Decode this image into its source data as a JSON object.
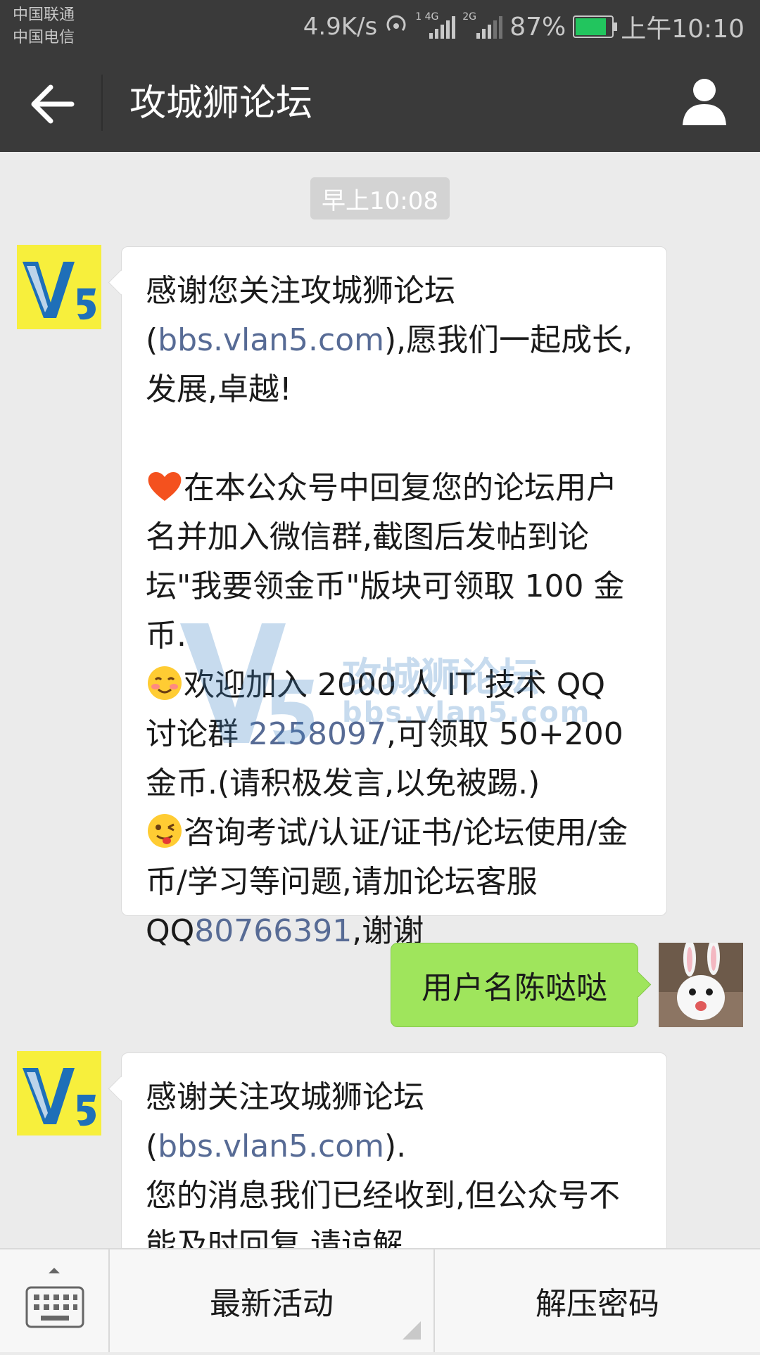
{
  "status_bar": {
    "carrier_1": "中国联通",
    "carrier_2": "中国电信",
    "net_speed": "4.9K/s",
    "signal_1_tag": "1 4G",
    "signal_2_tag": "2G",
    "battery": "87%",
    "time": "上午10:10"
  },
  "header": {
    "title": "攻城狮论坛",
    "back_icon": "arrow-left-icon",
    "profile_icon": "person-icon"
  },
  "chat": {
    "timestamp": "早上10:08",
    "message_1": {
      "line_a_pre": "感谢您关注攻城狮论坛(",
      "line_a_link": "bbs.vlan5.com",
      "line_a_post": "),愿我们一起成长,发展,卓越!",
      "para_2": "在本公众号中回复您的论坛用户名并加入微信群,截图后发帖到论坛\"我要领金币\"版块可领取 100 金币.",
      "para_3_pre": "欢迎加入 2000 人 IT 技术 QQ 讨论群 ",
      "para_3_link": "2258097",
      "para_3_post": ",可领取 50+200 金币.(请积极发言,以免被踢.)",
      "para_4_pre": "咨询考试/认证/证书/论坛使用/金币/学习等问题,请加论坛客服QQ",
      "para_4_link": "80766391",
      "para_4_post": ",谢谢"
    },
    "sent_message": "用户名陈哒哒",
    "message_2": {
      "line_a_pre": "感谢关注攻城狮论坛(",
      "line_a_link": "bbs.vlan5.com",
      "line_a_post": ").",
      "line_b": "您的消息我们已经收到,但公众号不能及时回复,请谅解."
    },
    "watermark_title": "攻城狮论坛",
    "watermark_url": "bbs.vlan5.com",
    "avatar_logo_text": "V5"
  },
  "bottom_menu": {
    "keyboard_icon": "keyboard-icon",
    "item_1": "最新活动",
    "item_2": "解压密码"
  },
  "colors": {
    "header_bg": "#3a3a3a",
    "chat_bg": "#ebebeb",
    "sent_bubble": "#9fe55c",
    "link": "#576b95",
    "avatar_bg": "#f7ef3c"
  }
}
